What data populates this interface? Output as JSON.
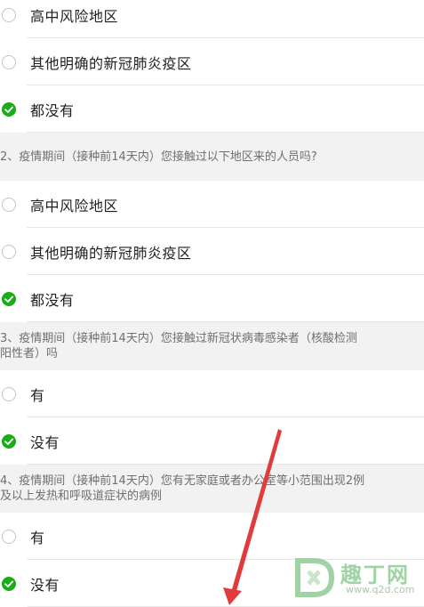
{
  "q1": {
    "options": [
      {
        "label": "高中风险地区",
        "selected": false
      },
      {
        "label": "其他明确的新冠肺炎疫区",
        "selected": false
      },
      {
        "label": "都没有",
        "selected": true
      }
    ]
  },
  "q2": {
    "question": "2、疫情期间（接种前14天内）您接触过以下地区来的人员吗?",
    "options": [
      {
        "label": "高中风险地区",
        "selected": false
      },
      {
        "label": "其他明确的新冠肺炎疫区",
        "selected": false
      },
      {
        "label": "都没有",
        "selected": true
      }
    ]
  },
  "q3": {
    "question_line1": "3、疫情期间（接种前14天内）您接触过新冠状病毒感染者（核酸检测",
    "question_line2": "阳性者）吗",
    "options": [
      {
        "label": "有",
        "selected": false
      },
      {
        "label": "没有",
        "selected": true
      }
    ]
  },
  "q4": {
    "question_line1": "4、疫情期间（接种前14天内）您有无家庭或者办公室等小范围出现2例",
    "question_line2": "及以上发热和呼吸道症状的病例",
    "options": [
      {
        "label": "有",
        "selected": false
      },
      {
        "label": "没有",
        "selected": true
      }
    ]
  },
  "watermark": {
    "brand": "趣丁网",
    "url": "www.q2d.com"
  },
  "colors": {
    "check": "#1aad19",
    "question_bg": "#f2f2f2",
    "arrow": "#e23b3b"
  }
}
